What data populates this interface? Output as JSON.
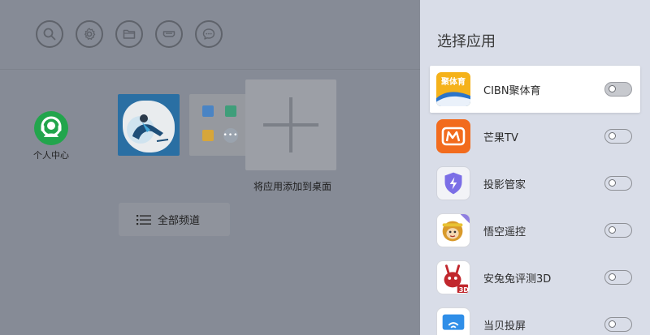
{
  "home": {
    "profile_label": "个人中心",
    "add_label": "将应用添加到桌面",
    "all_channels_label": "全部频道"
  },
  "panel": {
    "title": "选择应用",
    "apps": [
      {
        "name": "CIBN聚体育",
        "icon_text": "聚体育",
        "selected": true,
        "enabled": false
      },
      {
        "name": "芒果TV",
        "icon_text": "",
        "selected": false,
        "enabled": false
      },
      {
        "name": "投影管家",
        "icon_text": "",
        "selected": false,
        "enabled": false
      },
      {
        "name": "悟空遥控",
        "icon_text": "",
        "selected": false,
        "enabled": false
      },
      {
        "name": "安兔兔评测3D",
        "icon_text": "3D",
        "selected": false,
        "enabled": false
      },
      {
        "name": "当贝投屏",
        "icon_text": "",
        "selected": false,
        "enabled": false
      }
    ]
  },
  "colors": {
    "panel_bg": "#d9dde8",
    "overlay_bg": "#868b96",
    "profile_green": "#22a54c"
  }
}
